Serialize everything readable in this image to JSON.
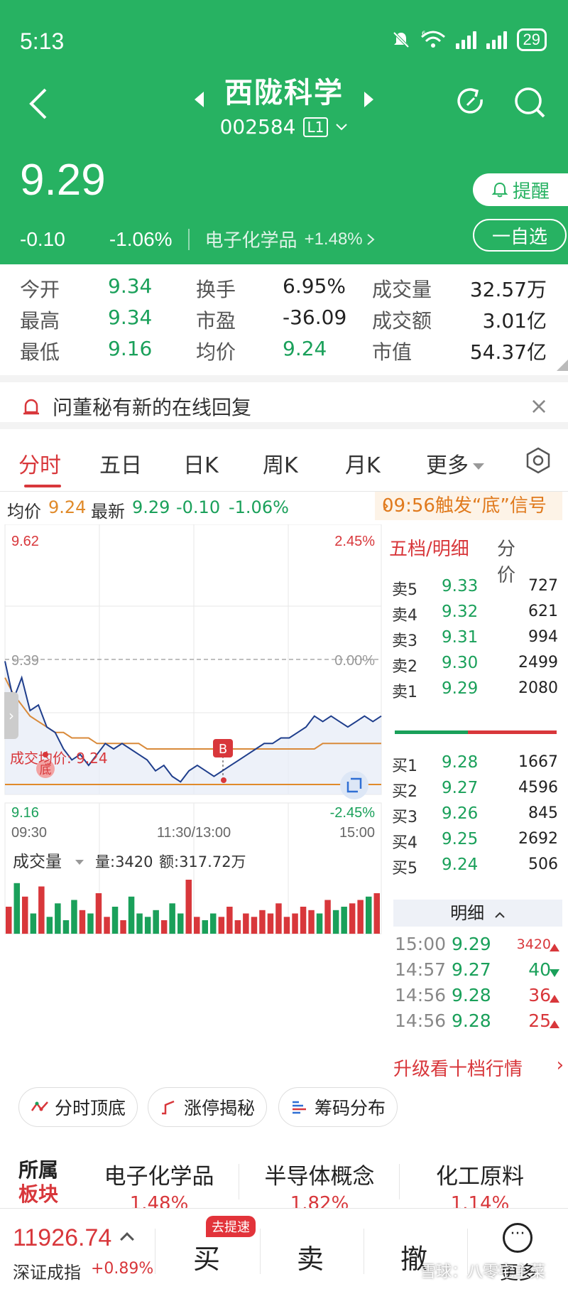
{
  "status": {
    "time": "5:13",
    "battery": "29",
    "signal_label": "6"
  },
  "header": {
    "stock_name": "西陇科学",
    "stock_code": "002584",
    "level": "L1",
    "price": "9.29",
    "change": "-0.10",
    "change_pct": "-1.06%",
    "sector_name": "电子化学品",
    "sector_change": "+1.48%",
    "alert_label": "提醒",
    "watch_label": "一自选"
  },
  "quote": {
    "open_label": "今开",
    "open": "9.34",
    "high_label": "最高",
    "high": "9.34",
    "low_label": "最低",
    "low": "9.16",
    "turnover_label": "换手",
    "turnover": "6.95%",
    "pe_label": "市盈",
    "pe": "-36.09",
    "avg_label": "均价",
    "avg": "9.24",
    "volume_label": "成交量",
    "volume": "32.57万",
    "amount_label": "成交额",
    "amount": "3.01亿",
    "mcap_label": "市值",
    "mcap": "54.37亿"
  },
  "notice": {
    "text": "问董秘有新的在线回复"
  },
  "tabs": [
    "分时",
    "五日",
    "日K",
    "周K",
    "月K",
    "更多"
  ],
  "info_line": {
    "avg_label": "均价",
    "avg": "9.24",
    "latest_label": "最新",
    "latest": "9.29",
    "change": "-0.10",
    "change_pct": "-1.06%",
    "signal": "09:56触发“底”信号"
  },
  "chart": {
    "price_top": "9.62",
    "pct_top": "2.45%",
    "price_mid": "9.39",
    "pct_mid": "0.00%",
    "price_bottom": "9.16",
    "pct_bottom": "-2.45%",
    "avg_annotation": "成交均价: 9.24",
    "bottom_marker": "底",
    "buy_marker": "B",
    "time_start": "09:30",
    "time_mid": "11:30/13:00",
    "time_end": "15:00",
    "volume_label": "成交量",
    "volume_value": "量:3420",
    "amount_value": "额:317.72万"
  },
  "chart_data": {
    "type": "line",
    "x": [
      "09:30",
      "11:30/13:00",
      "15:00"
    ],
    "ylim": [
      9.16,
      9.62
    ],
    "series": [
      {
        "values": [
          9.39,
          9.32,
          9.36,
          9.3,
          9.31,
          9.27,
          9.26,
          9.23,
          9.21,
          9.22,
          9.2,
          9.22,
          9.24,
          9.23,
          9.24,
          9.23,
          9.22,
          9.21,
          9.19,
          9.2,
          9.18,
          9.17,
          9.19,
          9.2,
          9.19,
          9.18,
          9.19,
          9.2,
          9.21,
          9.22,
          9.23,
          9.24,
          9.24,
          9.25,
          9.25,
          9.26,
          9.27,
          9.29,
          9.28,
          9.29,
          9.28,
          9.27,
          9.28,
          9.29,
          9.28,
          9.29
        ]
      },
      {
        "values": [
          9.36,
          9.33,
          9.31,
          9.29,
          9.28,
          9.27,
          9.26,
          9.26,
          9.25,
          9.25,
          9.25,
          9.24,
          9.24,
          9.24,
          9.24,
          9.24,
          9.24,
          9.23,
          9.23,
          9.23,
          9.23,
          9.23,
          9.23,
          9.23,
          9.23,
          9.23,
          9.23,
          9.23,
          9.23,
          9.23,
          9.23,
          9.23,
          9.23,
          9.23,
          9.23,
          9.23,
          9.23,
          9.23,
          9.24,
          9.24,
          9.24,
          9.24,
          9.24,
          9.24,
          9.24,
          9.24
        ]
      }
    ],
    "volume_values": [
      40,
      75,
      55,
      30,
      70,
      25,
      45,
      20,
      50,
      35,
      30,
      60,
      25,
      40,
      20,
      55,
      30,
      25,
      35,
      20,
      45,
      30,
      80,
      25,
      20,
      30,
      25,
      40,
      20,
      30,
      25,
      35,
      30,
      45,
      25,
      30,
      40,
      35,
      30,
      50,
      35,
      40,
      45,
      50,
      55,
      60
    ],
    "grid": true
  },
  "orderbook": {
    "tab_left": "五档/明细",
    "tab_right": "分价",
    "asks": [
      {
        "label": "卖5",
        "price": "9.33",
        "vol": "727"
      },
      {
        "label": "卖4",
        "price": "9.32",
        "vol": "621"
      },
      {
        "label": "卖3",
        "price": "9.31",
        "vol": "994"
      },
      {
        "label": "卖2",
        "price": "9.30",
        "vol": "2499"
      },
      {
        "label": "卖1",
        "price": "9.29",
        "vol": "2080"
      }
    ],
    "bids": [
      {
        "label": "买1",
        "price": "9.28",
        "vol": "1667"
      },
      {
        "label": "买2",
        "price": "9.27",
        "vol": "4596"
      },
      {
        "label": "买3",
        "price": "9.26",
        "vol": "845"
      },
      {
        "label": "买4",
        "price": "9.25",
        "vol": "2692"
      },
      {
        "label": "买5",
        "price": "9.24",
        "vol": "506"
      }
    ],
    "bid_ratio": 0.45,
    "detail_label": "明细",
    "ticks": [
      {
        "time": "15:00",
        "price": "9.29",
        "vol": "3420",
        "dir": "up"
      },
      {
        "time": "14:57",
        "price": "9.27",
        "vol": "40",
        "dir": "down"
      },
      {
        "time": "14:56",
        "price": "9.28",
        "vol": "36",
        "dir": "up"
      },
      {
        "time": "14:56",
        "price": "9.28",
        "vol": "25",
        "dir": "up"
      }
    ],
    "upgrade_label": "升级看十档行情"
  },
  "features": [
    "分时顶底",
    "涨停揭秘",
    "筹码分布"
  ],
  "concepts": {
    "label_line1": "所属",
    "label_line2": "板块",
    "items": [
      {
        "name": "电子化学品",
        "chg": "1.48%"
      },
      {
        "name": "半导体概念",
        "chg": "1.82%"
      },
      {
        "name": "化工原料",
        "chg": "1.14%"
      }
    ]
  },
  "bottom": {
    "index_value": "11926.74",
    "index_name": "深证成指",
    "index_change": "+0.89%",
    "fast_badge": "去提速",
    "buy": "买",
    "sell": "卖",
    "cancel": "撤",
    "more": "更多",
    "more_icon": "···"
  },
  "watermark": "雪球：八零宅主菜",
  "colors": {
    "brand_green": "#27b262",
    "up_red": "#d8373b",
    "down_green": "#1aa05a",
    "price_line": "#1f3e8c",
    "avg_line": "#d98a3a"
  }
}
